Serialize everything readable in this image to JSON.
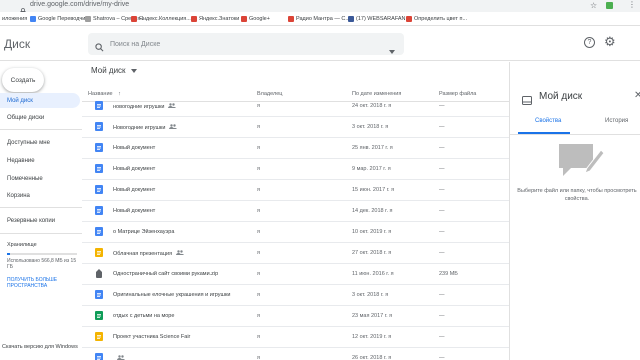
{
  "browser": {
    "url": "drive.google.com/drive/my-drive",
    "bookmarks": [
      {
        "label": "иложения",
        "color": "#5f6368"
      },
      {
        "label": "Google Переводчик",
        "color": "#4285f4"
      },
      {
        "label": "Shatrova – Средня...",
        "color": "#9e9e9e"
      },
      {
        "label": "Яндекс.Коллекция...",
        "color": "#db4437"
      },
      {
        "label": "Яндекс.Знатоки",
        "color": "#db4437"
      },
      {
        "label": "Google+",
        "color": "#db4437"
      },
      {
        "label": "Радио Мантра — С...",
        "color": "#db4437"
      },
      {
        "label": "(17) WEBSARAFAN...",
        "color": "#3b5998"
      },
      {
        "label": "Определить цвет п...",
        "color": "#db4437"
      }
    ]
  },
  "app": {
    "title": "Диск",
    "search_placeholder": "Поиск на Диске"
  },
  "sidebar": {
    "new_label": "Создать",
    "items": [
      {
        "label": "Мой диск",
        "active": true
      },
      {
        "label": "Общие диски",
        "active": false
      },
      {
        "label": "Доступные мне",
        "active": false
      },
      {
        "label": "Недавние",
        "active": false
      },
      {
        "label": "Помеченные",
        "active": false
      },
      {
        "label": "Корзина",
        "active": false
      },
      {
        "label": "Резервные копии",
        "active": false
      }
    ],
    "storage_label": "Хранилище",
    "storage_fraction": 0.04,
    "storage_used": "Использовано 566,8 МБ из 15 ГБ",
    "buy_link": "ПОЛУЧИТЬ БОЛЬШЕ ПРОСТРАНСТВА",
    "download_link": "Скачать версию для Windows"
  },
  "main": {
    "title": "Мой диск",
    "columns": {
      "name": "Название",
      "owner": "Владелец",
      "modified": "По дате изменения",
      "size": "Размер файла"
    },
    "files": [
      {
        "name": "новогодние игрушки",
        "type": "doc",
        "shared": true,
        "owner": "я",
        "modified": "24 окт. 2018 г. я",
        "size": "—"
      },
      {
        "name": "Новогодние игрушки",
        "type": "doc",
        "shared": true,
        "owner": "я",
        "modified": "3 окт. 2018 г. я",
        "size": "—"
      },
      {
        "name": "Новый документ",
        "type": "doc",
        "shared": false,
        "owner": "я",
        "modified": "25 янв. 2017 г. я",
        "size": "—"
      },
      {
        "name": "Новый документ",
        "type": "doc",
        "shared": false,
        "owner": "я",
        "modified": "9 мар. 2017 г. я",
        "size": "—"
      },
      {
        "name": "Новый документ",
        "type": "doc",
        "shared": false,
        "owner": "я",
        "modified": "15 июн. 2017 г. я",
        "size": "—"
      },
      {
        "name": "Новый документ",
        "type": "doc",
        "shared": false,
        "owner": "я",
        "modified": "14 дек. 2018 г. я",
        "size": "—"
      },
      {
        "name": "о Матрице Эйзенхауэра",
        "type": "doc",
        "shared": false,
        "owner": "я",
        "modified": "10 окт. 2019 г. я",
        "size": "—"
      },
      {
        "name": "Облачная презентация",
        "type": "slides",
        "shared": true,
        "owner": "я",
        "modified": "27 окт. 2018 г. я",
        "size": "—"
      },
      {
        "name": "Одностраничный сайт своими руками.zip",
        "type": "zip",
        "shared": false,
        "owner": "я",
        "modified": "11 июн. 2016 г. я",
        "size": "239 МБ"
      },
      {
        "name": "Оригинальные елочные украшения и игрушки",
        "type": "doc",
        "shared": false,
        "owner": "я",
        "modified": "3 окт. 2018 г. я",
        "size": "—"
      },
      {
        "name": "отдых с детьми на море",
        "type": "sheet",
        "shared": false,
        "owner": "я",
        "modified": "23 мая 2017 г. я",
        "size": "—"
      },
      {
        "name": "Проект участника Science Fair",
        "type": "slides",
        "shared": false,
        "owner": "я",
        "modified": "12 окт. 2019 г. я",
        "size": "—"
      },
      {
        "name": "",
        "type": "doc",
        "shared": true,
        "owner": "я",
        "modified": "26 окт. 2018 г. я",
        "size": "—"
      }
    ]
  },
  "details": {
    "title": "Мой диск",
    "tab_details": "Свойства",
    "tab_history": "История",
    "message": "Выберите файл или папку, чтобы просмотреть свойства."
  },
  "colors": {
    "accent": "#1a73e8",
    "doc": "#4285f4",
    "slides": "#f4b400",
    "sheet": "#0f9d58"
  }
}
